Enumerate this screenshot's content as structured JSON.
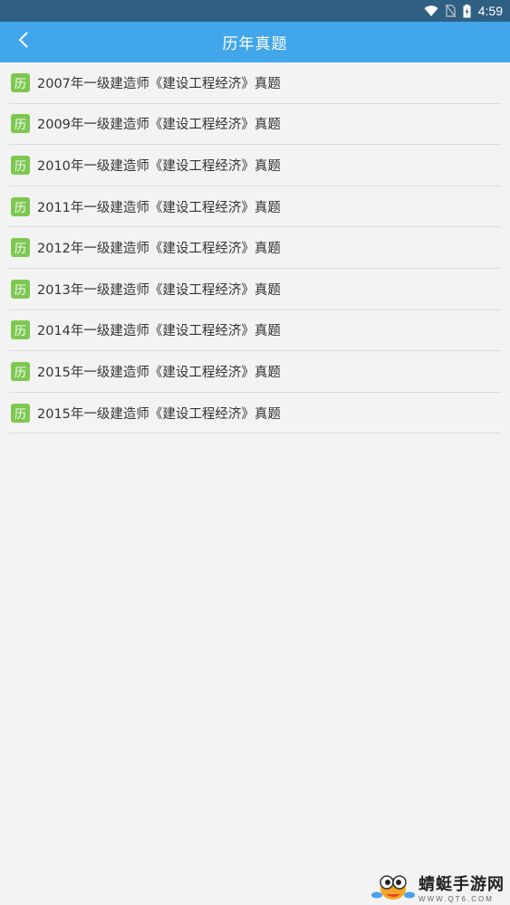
{
  "status_bar": {
    "time": "4:59",
    "icons": [
      "wifi-icon",
      "no-sim-icon",
      "battery-charging-icon"
    ]
  },
  "app_bar": {
    "title": "历年真题",
    "back_icon": "chevron-left-icon"
  },
  "list": {
    "badge_text": "历",
    "items": [
      {
        "label": "2007年一级建造师《建设工程经济》真题"
      },
      {
        "label": "2009年一级建造师《建设工程经济》真题"
      },
      {
        "label": "2010年一级建造师《建设工程经济》真题"
      },
      {
        "label": "2011年一级建造师《建设工程经济》真题"
      },
      {
        "label": "2012年一级建造师《建设工程经济》真题"
      },
      {
        "label": "2013年一级建造师《建设工程经济》真题"
      },
      {
        "label": "2014年一级建造师《建设工程经济》真题"
      },
      {
        "label": "2015年一级建造师《建设工程经济》真题"
      },
      {
        "label": "2015年一级建造师《建设工程经济》真题"
      }
    ]
  },
  "watermark": {
    "name": "蜻蜓手游网",
    "url": "WWW.QT6.COM"
  },
  "colors": {
    "status_bar": "#2f5f83",
    "app_bar": "#42a7ea",
    "badge": "#7dc851",
    "background": "#f3f3f3"
  }
}
